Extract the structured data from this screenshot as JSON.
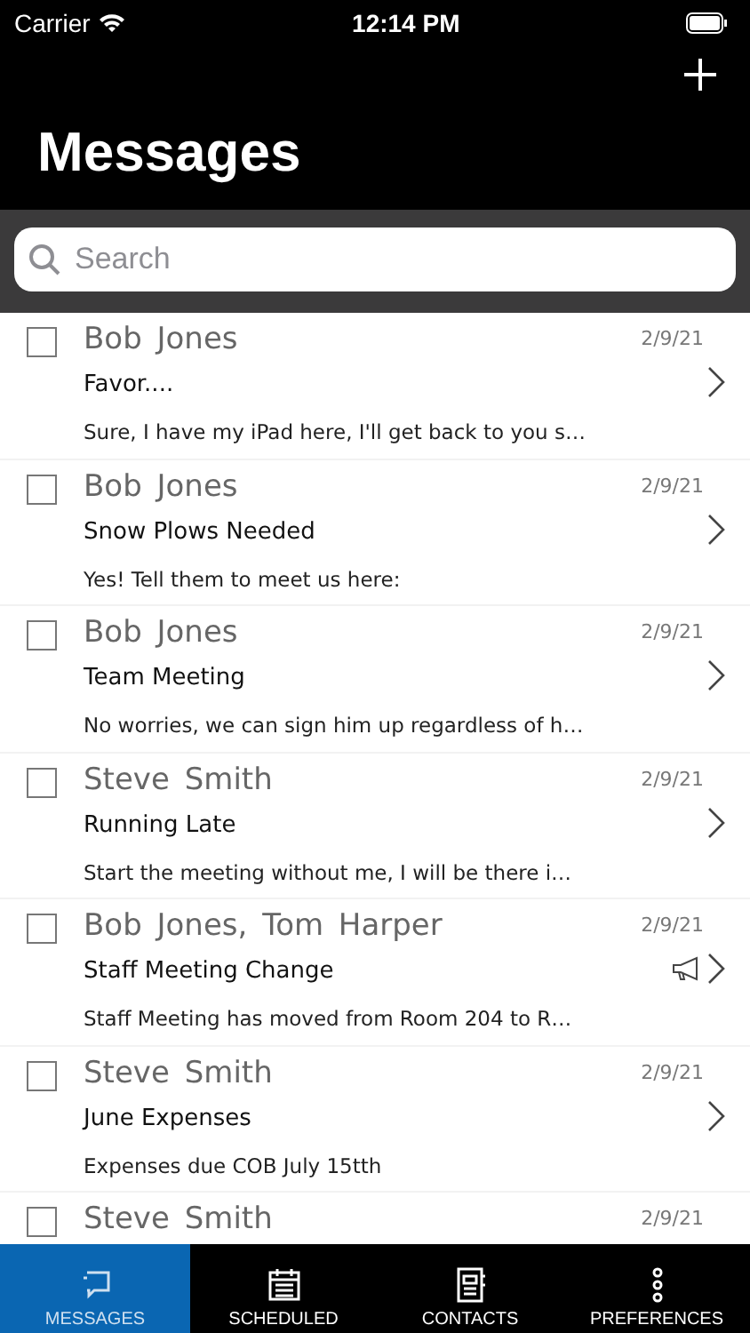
{
  "status_bar": {
    "carrier": "Carrier",
    "time": "12:14 PM"
  },
  "header": {
    "title": "Messages"
  },
  "search": {
    "placeholder": "Search"
  },
  "messages": [
    {
      "sender": "Bob Jones",
      "date": "2/9/21",
      "subject": "Favor....",
      "preview": "Sure, I have my iPad here, I'll get back to you s…",
      "checked": false,
      "broadcast": false
    },
    {
      "sender": "Bob Jones",
      "date": "2/9/21",
      "subject": "Snow Plows Needed",
      "preview": "Yes!  Tell them to meet us here:",
      "checked": false,
      "broadcast": false
    },
    {
      "sender": "Bob Jones",
      "date": "2/9/21",
      "subject": "Team Meeting",
      "preview": "No worries, we can sign him up regardless of h…",
      "checked": false,
      "broadcast": false
    },
    {
      "sender": "Steve Smith",
      "date": "2/9/21",
      "subject": "Running Late",
      "preview": "Start the meeting without me, I will be there i…",
      "checked": false,
      "broadcast": false
    },
    {
      "sender": "Bob Jones, Tom Harper",
      "date": "2/9/21",
      "subject": "Staff Meeting Change",
      "preview": "Staff Meeting has moved from Room 204 to R…",
      "checked": false,
      "broadcast": true
    },
    {
      "sender": "Steve Smith",
      "date": "2/9/21",
      "subject": "June Expenses",
      "preview": "Expenses due COB July 15tth",
      "checked": false,
      "broadcast": false
    },
    {
      "sender": "Steve Smith",
      "date": "2/9/21",
      "checked": false
    }
  ],
  "tabs": [
    {
      "label": "MESSAGES",
      "kind": "messages",
      "selected": true
    },
    {
      "label": "SCHEDULED",
      "kind": "calendar",
      "selected": false
    },
    {
      "label": "CONTACTS",
      "kind": "contacts",
      "selected": false
    },
    {
      "label": "PREFERENCES",
      "kind": "more",
      "selected": false
    }
  ]
}
